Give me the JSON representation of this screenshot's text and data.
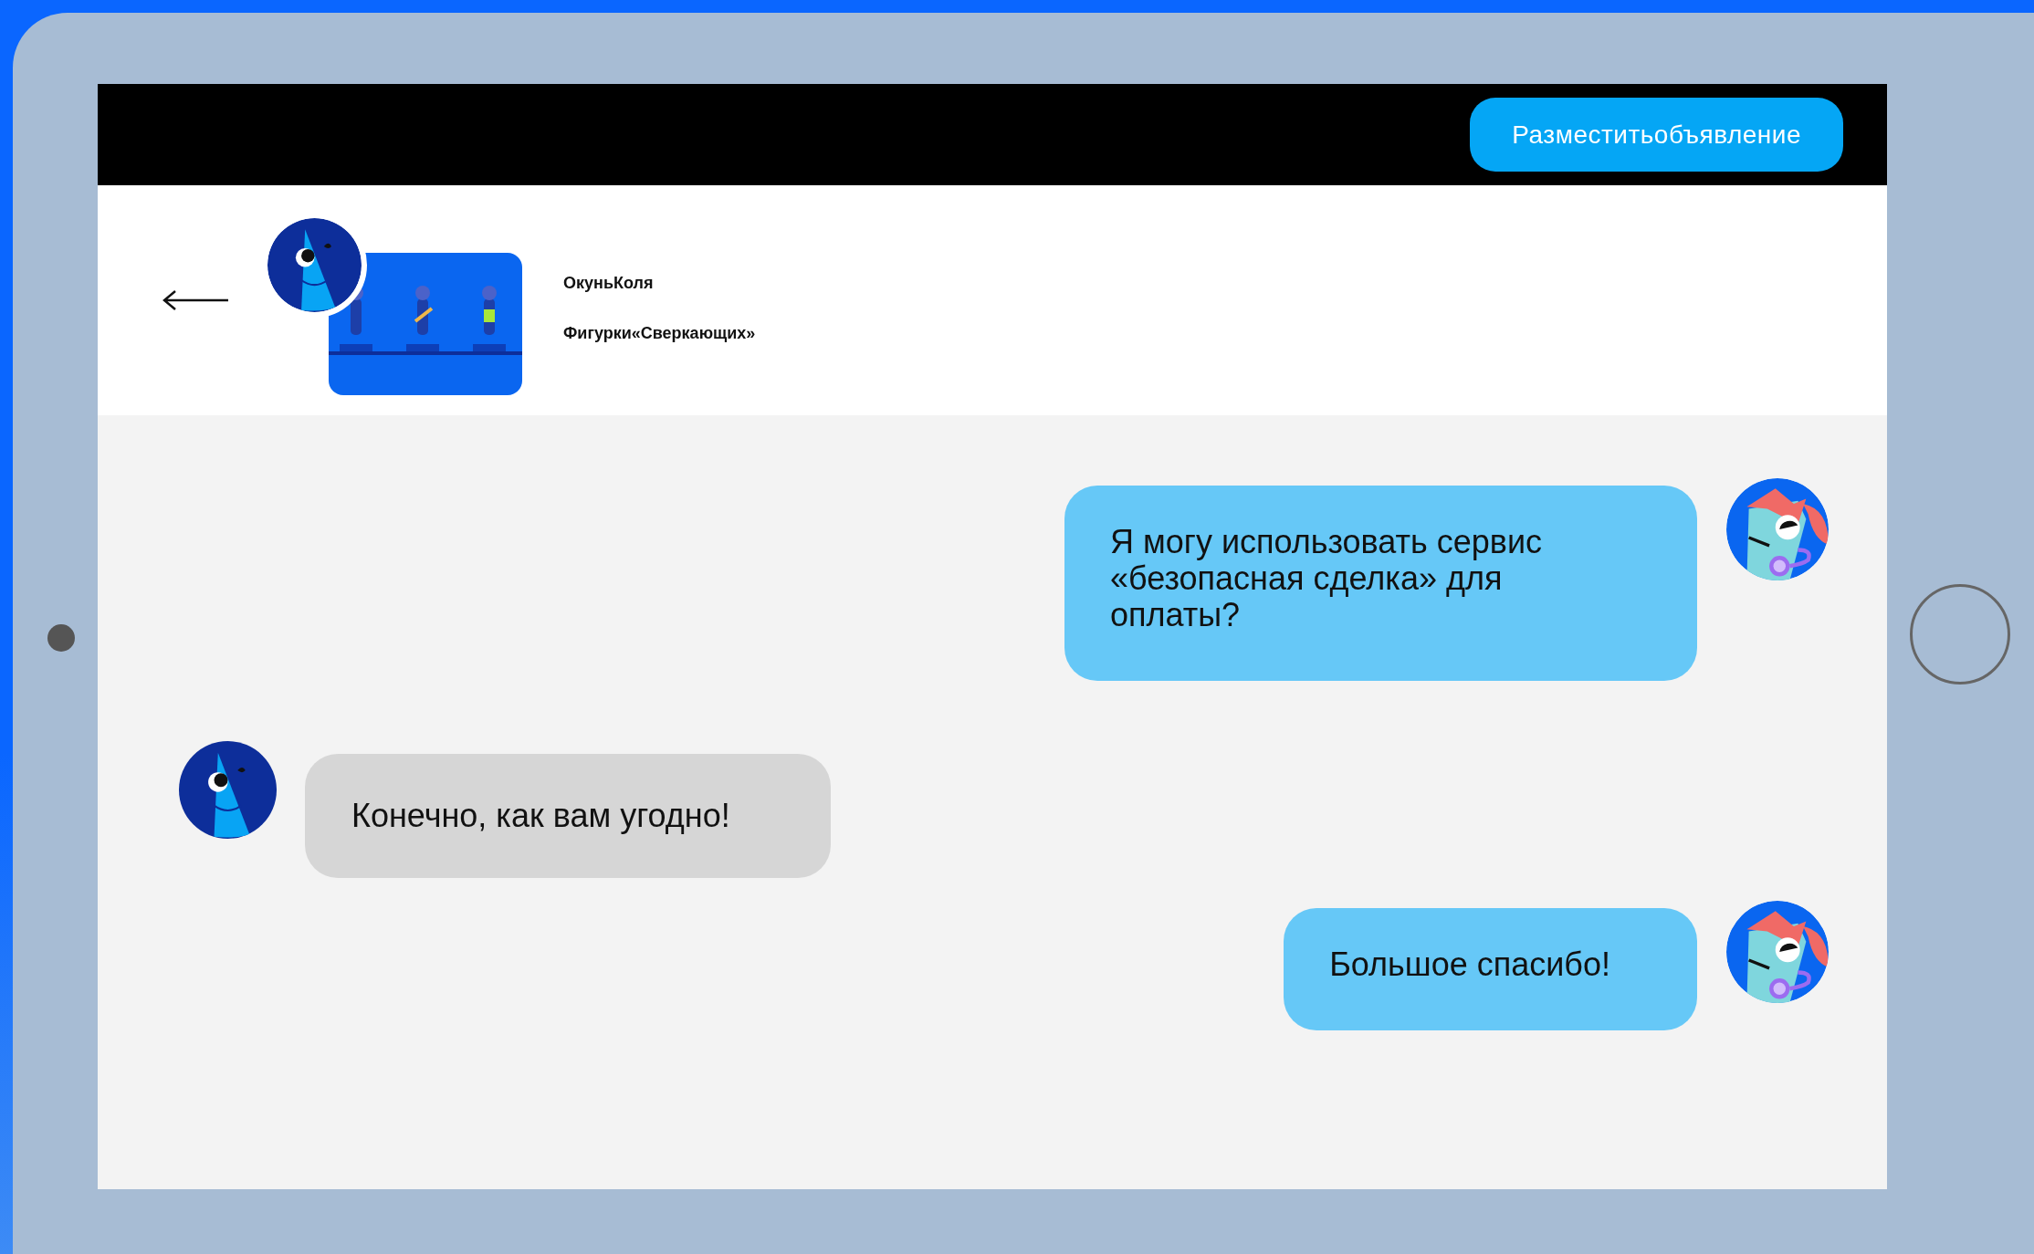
{
  "header": {
    "button": "Разместитьобъявление"
  },
  "deal": {
    "seller": "ОкуньКоля",
    "product": "Фигурки«Сверкающих»"
  },
  "messages": [
    {
      "kind": "outgoing",
      "text": "Я могу использовать сервис «безопасная сделка» для оплаты?"
    },
    {
      "kind": "incoming",
      "text": "Конечно, как вам угодно!"
    },
    {
      "kind": "outgoing",
      "text": "Большое спасибо!"
    }
  ]
}
